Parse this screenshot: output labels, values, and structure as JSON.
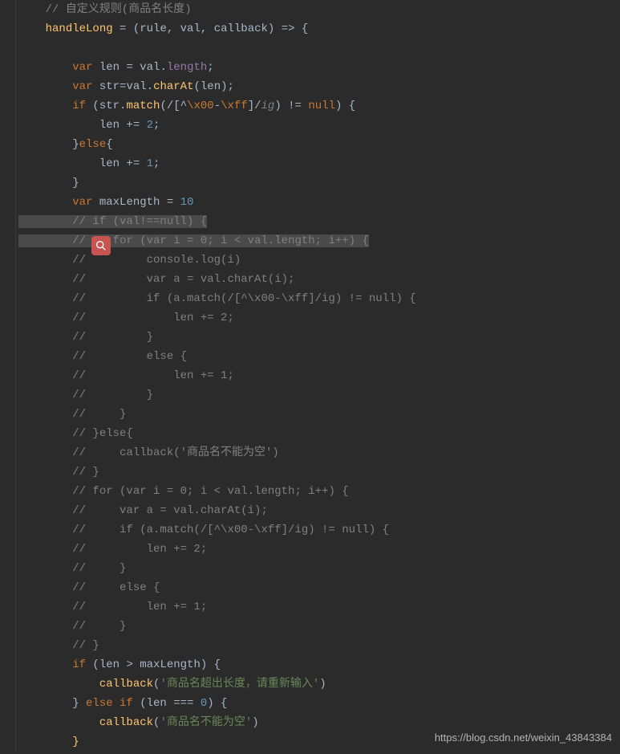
{
  "watermark": "https://blog.csdn.net/weixin_43843384",
  "lines": {
    "l1": "    // 自定义规则(商品名长度)",
    "l2a": "    ",
    "l2b": "handleLong",
    "l2c": " = (",
    "l2d": "rule",
    "l2e": ", ",
    "l2f": "val",
    "l2g": ", ",
    "l2h": "callback",
    "l2i": ") => {",
    "l4a": "        ",
    "l4b": "var",
    "l4c": " len = val.",
    "l4d": "length",
    "l4e": ";",
    "l5a": "        ",
    "l5b": "var",
    "l5c": " str=val.",
    "l5d": "charAt",
    "l5e": "(len);",
    "l6a": "        ",
    "l6b": "if",
    "l6c": " (str.",
    "l6d": "match",
    "l6e": "(",
    "l6f": "/[^",
    "l6g": "\\x00",
    "l6h": "-",
    "l6i": "\\xff",
    "l6j": "]/",
    "l6k": "ig",
    "l6l": ") != ",
    "l6m": "null",
    "l6n": ") {",
    "l7a": "            len += ",
    "l7b": "2",
    "l7c": ";",
    "l8a": "        }",
    "l8b": "else",
    "l8c": "{",
    "l9a": "            len += ",
    "l9b": "1",
    "l9c": ";",
    "l10": "        }",
    "l11a": "        ",
    "l11b": "var",
    "l11c": " maxLength = ",
    "l11d": "10",
    "l12": "        // if (val!==null) {",
    "l13": "        //    for (var i = 0; i < val.length; i++) {",
    "l14": "        //         console.log(i)",
    "l15": "        //         var a = val.charAt(i);",
    "l16": "        //         if (a.match(/[^\\x00-\\xff]/ig) != null) {",
    "l17": "        //             len += 2;",
    "l18": "        //         }",
    "l19": "        //         else {",
    "l20": "        //             len += 1;",
    "l21": "        //         }",
    "l22": "        //     }",
    "l23": "        // }else{",
    "l24": "        //     callback('商品名不能为空')",
    "l25": "        // }",
    "l26": "        // for (var i = 0; i < val.length; i++) {",
    "l27": "        //     var a = val.charAt(i);",
    "l28": "        //     if (a.match(/[^\\x00-\\xff]/ig) != null) {",
    "l29": "        //         len += 2;",
    "l30": "        //     }",
    "l31": "        //     else {",
    "l32": "        //         len += 1;",
    "l33": "        //     }",
    "l34": "        // }",
    "l35a": "        ",
    "l35b": "if",
    "l35c": " (len > maxLength) {",
    "l36a": "            ",
    "l36b": "callback",
    "l36c": "(",
    "l36d": "'商品名超出长度，请重新输入'",
    "l36e": ")",
    "l37a": "        } ",
    "l37b": "else if",
    "l37c": " (len === ",
    "l37d": "0",
    "l37e": ") {",
    "l38a": "            ",
    "l38b": "callback",
    "l38c": "(",
    "l38d": "'商品名不能为空'",
    "l38e": ")",
    "l39": "        }"
  }
}
